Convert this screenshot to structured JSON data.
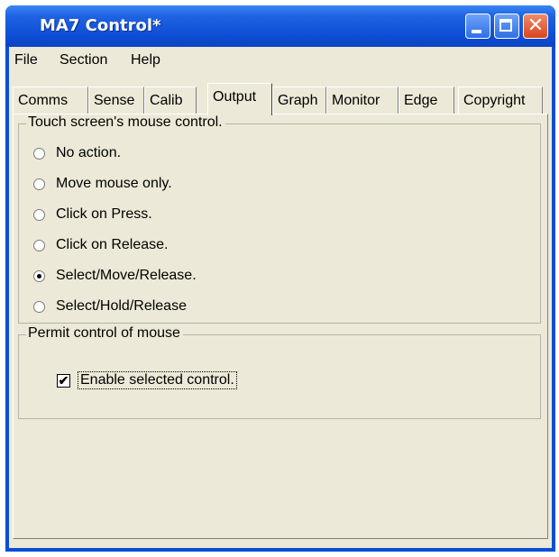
{
  "window": {
    "title": "MA7 Control*"
  },
  "menu": [
    "File",
    "Section",
    "Help"
  ],
  "tabs": [
    "Comms",
    "Sense",
    "Calib",
    "Output",
    "Graph",
    "Monitor",
    "Edge",
    "Copyright"
  ],
  "active_tab": "Output",
  "touch_group": {
    "legend": "Touch screen's mouse control.",
    "options": [
      "No action.",
      "Move mouse only.",
      "Click on Press.",
      "Click on Release.",
      "Select/Move/Release.",
      "Select/Hold/Release"
    ],
    "selected": "Select/Move/Release."
  },
  "permit_group": {
    "legend": "Permit control of mouse",
    "checkbox_label": "Enable selected control.",
    "checked": true,
    "check_glyph": "✔"
  },
  "titlebar_buttons": {
    "close_glyph": "✕"
  },
  "colors": {
    "titlebar": "#0f4fd6",
    "face": "#ece9d8"
  }
}
